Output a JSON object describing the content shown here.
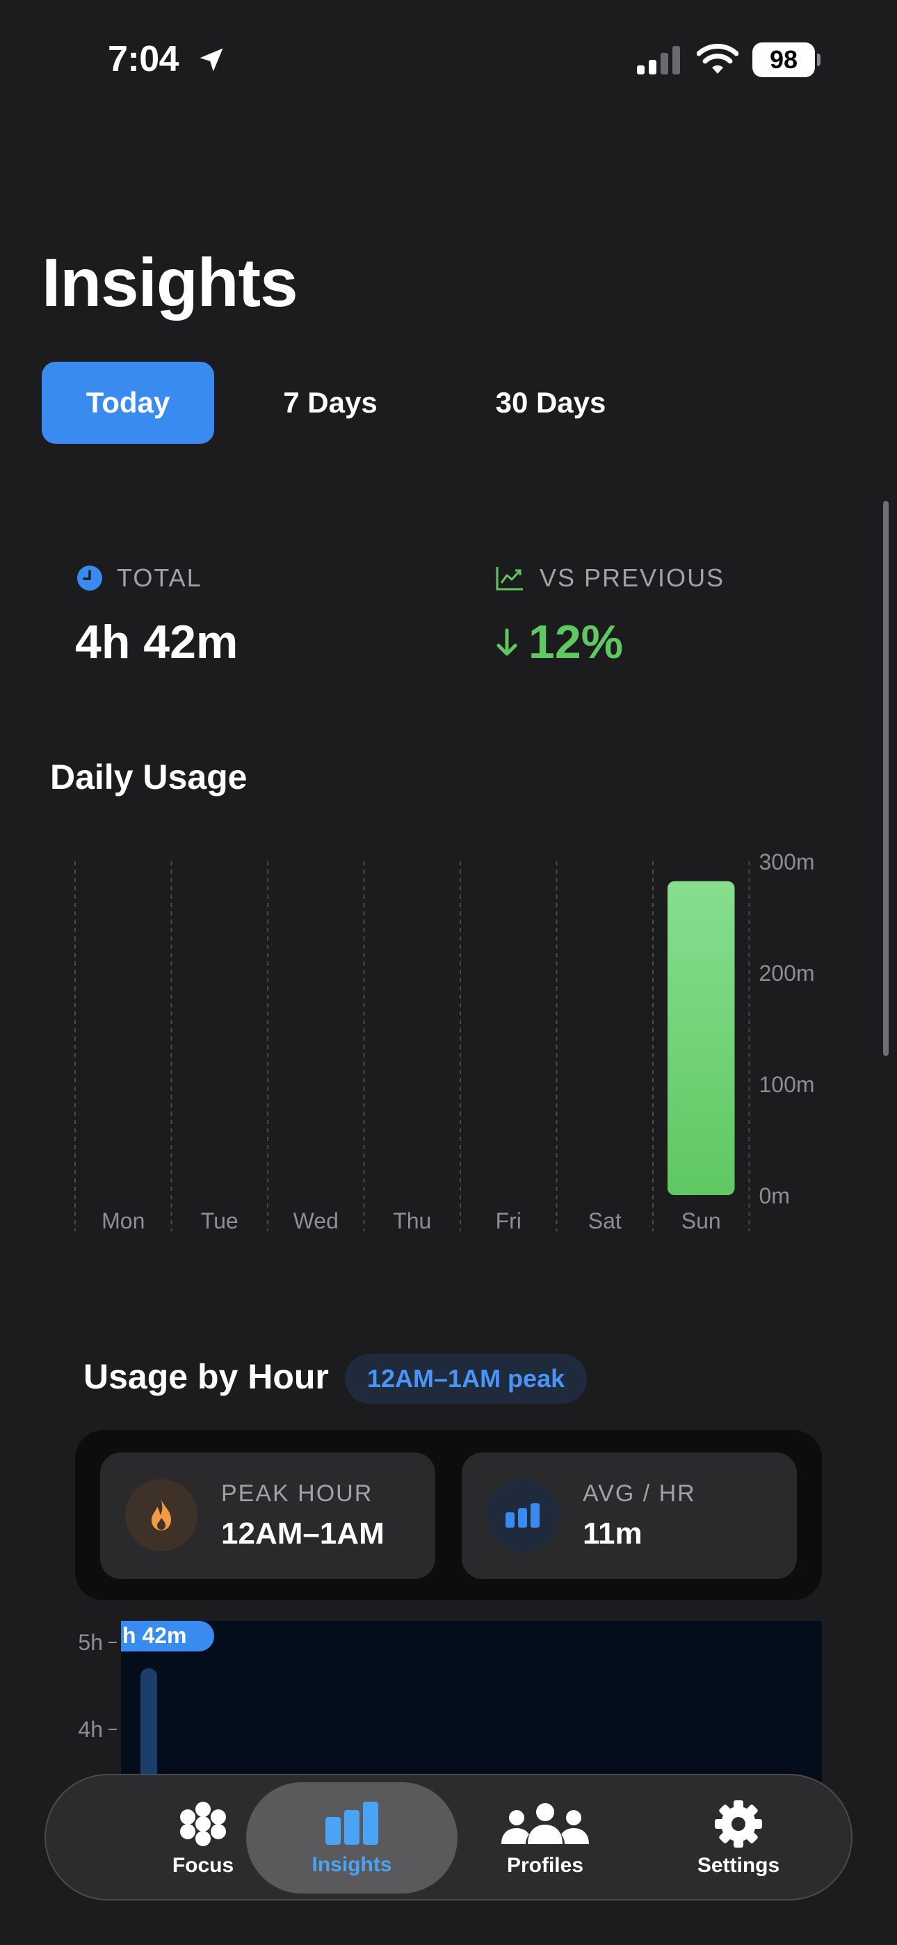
{
  "status_bar": {
    "time": "7:04",
    "battery": "98"
  },
  "page": {
    "title": "Insights"
  },
  "segments": [
    {
      "label": "Today",
      "active": true
    },
    {
      "label": "7 Days",
      "active": false
    },
    {
      "label": "30 Days",
      "active": false
    }
  ],
  "stats": {
    "total_label": "TOTAL",
    "total_value": "4h 42m",
    "vs_label": "VS PREVIOUS",
    "vs_value": "12%"
  },
  "daily_usage": {
    "title": "Daily Usage"
  },
  "chart_data": {
    "type": "bar",
    "categories": [
      "Mon",
      "Tue",
      "Wed",
      "Thu",
      "Fri",
      "Sat",
      "Sun"
    ],
    "values": [
      0,
      0,
      0,
      0,
      0,
      0,
      282
    ],
    "ylim": [
      0,
      300
    ],
    "yticks": [
      "0m",
      "100m",
      "200m",
      "300m"
    ],
    "colors": {
      "bar_top": "#86de8f",
      "bar_bottom": "#5fc862",
      "grid": "#4a4a4c",
      "tick": "#8e8e93"
    }
  },
  "usage_by_hour": {
    "title": "Usage by Hour",
    "badge": "12AM–1AM peak",
    "peak_label": "PEAK HOUR",
    "peak_value": "12AM–1AM",
    "avg_label": "AVG / HR",
    "avg_value": "11m",
    "chart": {
      "yticks": [
        "5h",
        "4h"
      ],
      "callout": "h 42m",
      "colors": {
        "bg": "#030d1c",
        "callout": "#3a8bf0",
        "bar": "#1b3e6a"
      }
    }
  },
  "tabbar": [
    {
      "label": "Focus",
      "icon": "flower-icon"
    },
    {
      "label": "Insights",
      "icon": "bar-chart-icon",
      "active": true
    },
    {
      "label": "Profiles",
      "icon": "people-icon"
    },
    {
      "label": "Settings",
      "icon": "gear-icon"
    }
  ]
}
